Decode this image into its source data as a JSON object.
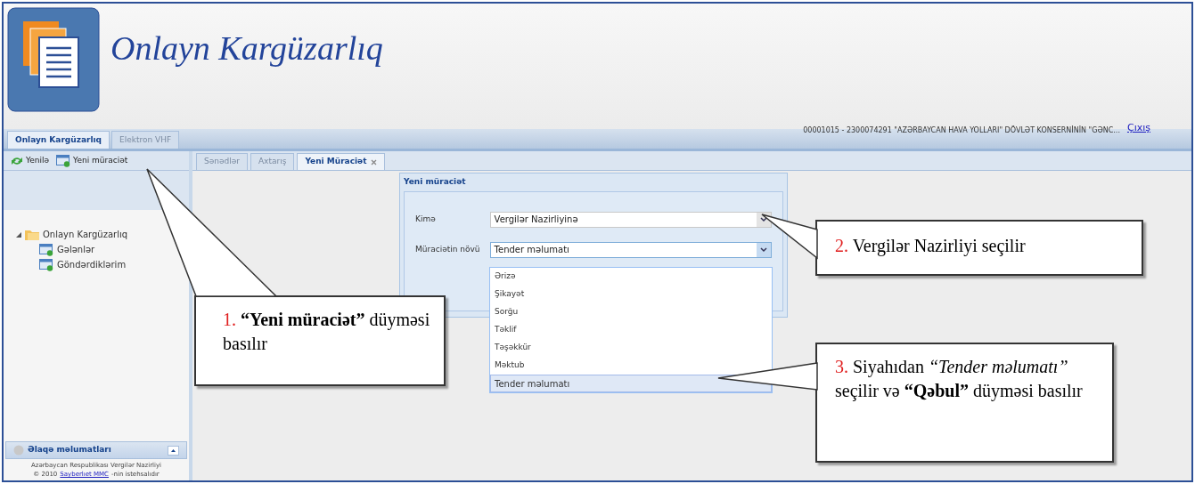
{
  "header": {
    "app_title": "Onlayn Kargüzarlıq",
    "user_info": "00001015 - 2300074291 \"AZƏRBAYCAN HAVA YOLLARI\" DÖVLƏT KONSERNİNİN \"GƏNC...",
    "logout_link": "Çıxış"
  },
  "top_tabs": [
    {
      "label": "Onlayn Kargüzarlıq",
      "selected": true
    },
    {
      "label": "Elektron VHF",
      "selected": false
    }
  ],
  "sidebar": {
    "toolbar": [
      {
        "label": "Yenilə"
      },
      {
        "label": "Yeni müraciət"
      }
    ],
    "tree": [
      {
        "label": "Onlayn Kargüzarlıq",
        "expanded": true,
        "children": [
          {
            "label": "Gələnlər"
          },
          {
            "label": "Göndərdiklərim"
          }
        ]
      }
    ],
    "contact_panel": {
      "title": "Əlaqə məlumatları",
      "footer_line1": "Azərbaycan Respublikası Vergilər Nazirliyi",
      "footer_line2_prefix": "© 2010",
      "footer_link": "Sayberlıet MMC",
      "footer_line2_suffix": "-nin istehsalıdır"
    }
  },
  "content_tabs": [
    {
      "label": "Sənədlər",
      "selected": false,
      "closable": false
    },
    {
      "label": "Axtarış",
      "selected": false,
      "closable": false
    },
    {
      "label": "Yeni Müraciət",
      "selected": true,
      "closable": true
    }
  ],
  "dialog": {
    "title": "Yeni müraciət",
    "fields": [
      {
        "label": "Kimə",
        "value": "Vergilər Nazirliyinə",
        "open": false
      },
      {
        "label": "Müraciətin növü",
        "value": "Tender məlumatı",
        "open": true
      }
    ],
    "dropdown_options": [
      {
        "label": "Ərizə",
        "selected": false
      },
      {
        "label": "Şikayət",
        "selected": false
      },
      {
        "label": "Sorğu",
        "selected": false
      },
      {
        "label": "Təklif",
        "selected": false
      },
      {
        "label": "Təşəkkür",
        "selected": false
      },
      {
        "label": "Məktub",
        "selected": false
      },
      {
        "label": "Tender məlumatı",
        "selected": true
      }
    ]
  },
  "callouts": [
    {
      "number": "1.",
      "text": "**“Yeni müraciət”** düyməsi basılır"
    },
    {
      "number": "2.",
      "text": "Vergilər  Nazirliyi  seçilir"
    },
    {
      "number": "3.",
      "text": "Siyahıdan *“Tender məlumatı”* seçilir  və **“Qəbul”**  düyməsi basılır"
    }
  ]
}
